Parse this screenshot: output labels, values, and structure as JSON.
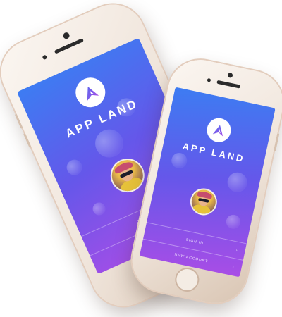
{
  "app": {
    "brand_name": "APP LAND",
    "sign_in_label": "SIGN IN",
    "new_account_label": "NEW ACCOUNT"
  },
  "colors": {
    "gradient_top": "#3d7cf2",
    "gradient_mid": "#6557ea",
    "gradient_bottom": "#a94de6",
    "phone_body": "#efe4da"
  },
  "icons": {
    "logo": "triangle-play-logo",
    "row_action": "chevron-right-icon"
  }
}
